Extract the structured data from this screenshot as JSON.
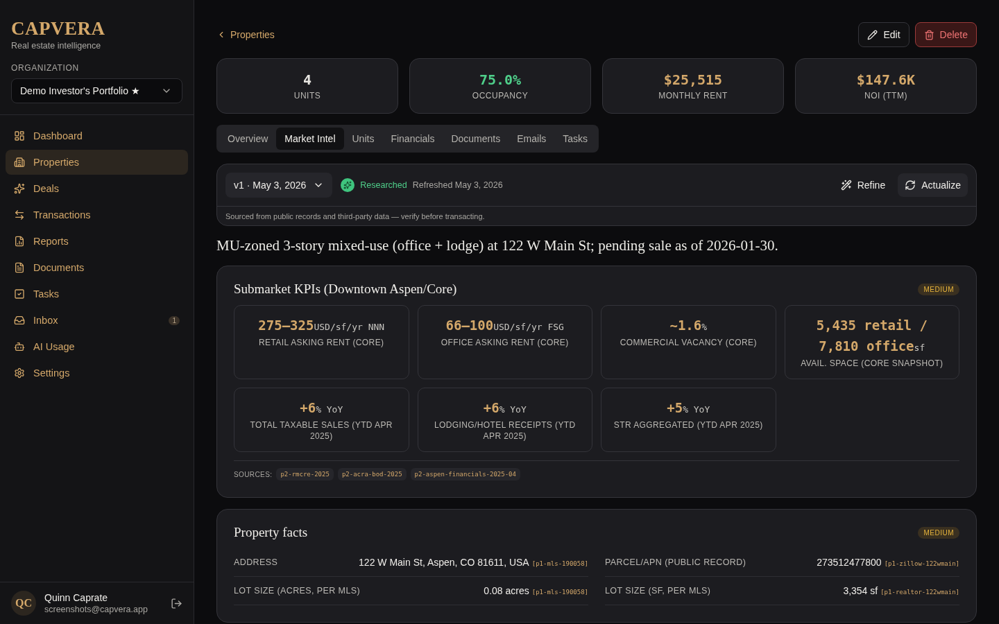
{
  "brand": {
    "name": "CAPVERA",
    "tagline": "Real estate intelligence"
  },
  "organization": {
    "label": "ORGANIZATION",
    "value": "Demo Investor's Portfolio ★"
  },
  "sidebar": {
    "items": [
      {
        "kind": "dashboard",
        "label": "Dashboard",
        "selected": false
      },
      {
        "kind": "properties",
        "label": "Properties",
        "selected": true
      },
      {
        "kind": "deals",
        "label": "Deals",
        "selected": false
      },
      {
        "kind": "transactions",
        "label": "Transactions",
        "selected": false
      },
      {
        "kind": "reports",
        "label": "Reports",
        "selected": false
      },
      {
        "kind": "documents",
        "label": "Documents",
        "selected": false
      },
      {
        "kind": "tasks",
        "label": "Tasks",
        "selected": false
      },
      {
        "kind": "inbox",
        "label": "Inbox",
        "selected": false,
        "badge": "1"
      },
      {
        "kind": "usage",
        "label": "AI Usage",
        "selected": false
      },
      {
        "kind": "settings",
        "label": "Settings",
        "selected": false
      }
    ]
  },
  "user": {
    "initials": "QC",
    "name": "Quinn Caprate",
    "email": "screenshots@capvera.app"
  },
  "breadcrumb": "Properties",
  "actions": [
    {
      "kind": "edit",
      "label": "Edit"
    },
    {
      "kind": "delete",
      "label": "Delete"
    }
  ],
  "stats": [
    {
      "value": "4",
      "label": "UNITS",
      "color": "#e8e6e1"
    },
    {
      "value": "75.0%",
      "label": "OCCUPANCY",
      "color": "#4fcf8a"
    },
    {
      "value": "$25,515",
      "label": "MONTHLY RENT",
      "color": "#d4a86a"
    },
    {
      "value": "$147.6K",
      "label": "NOI (TTM)",
      "color": "#d4a86a"
    }
  ],
  "tabs": [
    {
      "label": "Overview",
      "selected": false
    },
    {
      "label": "Market Intel",
      "selected": true
    },
    {
      "label": "Units",
      "selected": false
    },
    {
      "label": "Financials",
      "selected": false
    },
    {
      "label": "Documents",
      "selected": false
    },
    {
      "label": "Emails",
      "selected": false
    },
    {
      "label": "Tasks",
      "selected": false
    }
  ],
  "research": {
    "version": "v1 · May 3, 2026",
    "status": "Researched",
    "refreshed": "Refreshed May 3, 2026",
    "buttons": [
      {
        "kind": "refine",
        "label": "Refine"
      },
      {
        "kind": "actualize",
        "label": "Actualize"
      }
    ],
    "disclaimer": "Sourced from public records and third-party data — verify before transacting."
  },
  "summary": "MU-zoned 3-story mixed-use (office + lodge) at 122 W Main St; pending sale as of 2026-01-30.",
  "kpi_section": {
    "title": "Submarket KPIs (Downtown Aspen/Core)",
    "confidence": "MEDIUM",
    "kpis": [
      {
        "value": "275–325",
        "unit": "USD/sf/yr NNN",
        "label": "RETAIL ASKING RENT (CORE)"
      },
      {
        "value": "66–100",
        "unit": "USD/sf/yr FSG",
        "label": "OFFICE ASKING RENT (CORE)"
      },
      {
        "value": "~1.6",
        "unit": "%",
        "label": "COMMERCIAL VACANCY (CORE)"
      },
      {
        "value": "5,435 retail / 7,810 office",
        "unit": "sf",
        "label": "AVAIL. SPACE (CORE SNAPSHOT)"
      },
      {
        "value": "+6",
        "unit": "% YoY",
        "label": "TOTAL TAXABLE SALES (YTD APR 2025)"
      },
      {
        "value": "+6",
        "unit": "% YoY",
        "label": "LODGING/HOTEL RECEIPTS (YTD APR 2025)"
      },
      {
        "value": "+5",
        "unit": "% YoY",
        "label": "STR AGGREGATED (YTD APR 2025)"
      }
    ],
    "sources_label": "SOURCES:",
    "sources": [
      "p2-rmcre-2025",
      "p2-acra-bod-2025",
      "p2-aspen-financials-2025-04"
    ]
  },
  "facts_section": {
    "title": "Property facts",
    "confidence": "MEDIUM",
    "facts": [
      {
        "label": "ADDRESS",
        "value": "122 W Main St, Aspen, CO 81611, USA",
        "source": "[p1-mls-190058]"
      },
      {
        "label": "PARCEL/APN (PUBLIC RECORD)",
        "value": "273512477800",
        "source": "[p1-zillow-122wmain]"
      },
      {
        "label": "LOT SIZE (ACRES, PER MLS)",
        "value": "0.08 acres",
        "source": "[p1-mls-190058]"
      },
      {
        "label": "LOT SIZE (SF, PER MLS)",
        "value": "3,354 sf",
        "source": "[p1-realtor-122wmain]"
      }
    ]
  }
}
